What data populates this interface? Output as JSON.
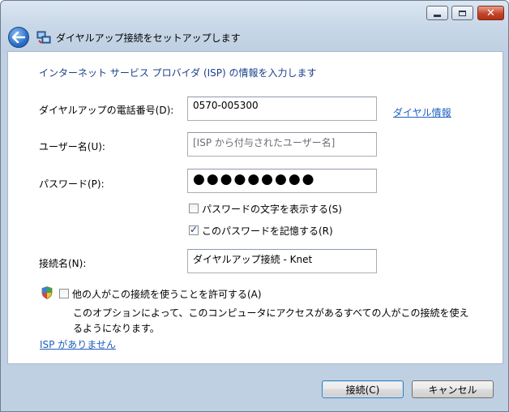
{
  "window": {
    "title": "ダイヤルアップ接続をセットアップします",
    "controls": [
      "minimize",
      "maximize",
      "close"
    ]
  },
  "heading": "インターネット サービス プロバイダ (ISP) の情報を入力します",
  "form": {
    "phone": {
      "label": "ダイヤルアップの電話番号(D):",
      "value": "0570-005300",
      "link": "ダイヤル情報"
    },
    "username": {
      "label": "ユーザー名(U):",
      "placeholder": "[ISP から付与されたユーザー名]"
    },
    "password": {
      "label": "パスワード(P):",
      "masked": "●●●●●●●●●"
    },
    "show_password": {
      "label": "パスワードの文字を表示する(S)",
      "checked": false
    },
    "remember_password": {
      "label": "このパスワードを記憶する(R)",
      "checked": true
    },
    "connection_name": {
      "label": "接続名(N):",
      "value": "ダイヤルアップ接続 - Knet"
    }
  },
  "allow_others": {
    "label": "他の人がこの接続を使うことを許可する(A)",
    "checked": false,
    "description": "このオプションによって、このコンピュータにアクセスがあるすべての人がこの接続を使えるようになります。"
  },
  "no_isp_link": "ISP がありません",
  "buttons": {
    "connect": "接続(C)",
    "cancel": "キャンセル"
  }
}
